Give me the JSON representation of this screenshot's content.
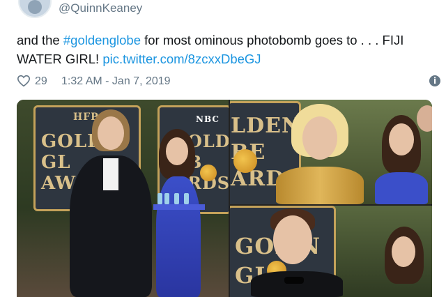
{
  "tweet": {
    "handle": "@QuinnKeaney",
    "text_before": "and the ",
    "hashtag": "#goldenglobe",
    "text_after": " for most ominous photobomb goes to . . . FIJI WATER GIRL! ",
    "pic_link": "pic.twitter.com/8zcxxDbeGJ",
    "likes": "29",
    "timestamp": "1:32 AM - Jan 7, 2019"
  },
  "icons": {
    "like": "heart-icon",
    "info": "info-icon"
  },
  "colors": {
    "link": "#1b95e0",
    "meta": "#657786",
    "text": "#14171a"
  },
  "media": {
    "left_photo": {
      "backdrop_brand": "HFPA",
      "backdrop_text_1": "GOLD\nGL\nAW",
      "backdrop_brand_2": "NBC",
      "backdrop_text_2": "OLDE\nB\nRDS"
    },
    "top_right_photo": {
      "backdrop_text": "LDEN\nBE\nARD"
    },
    "bottom_right_photo": {
      "backdrop_text": "GOL N\nGL"
    }
  }
}
